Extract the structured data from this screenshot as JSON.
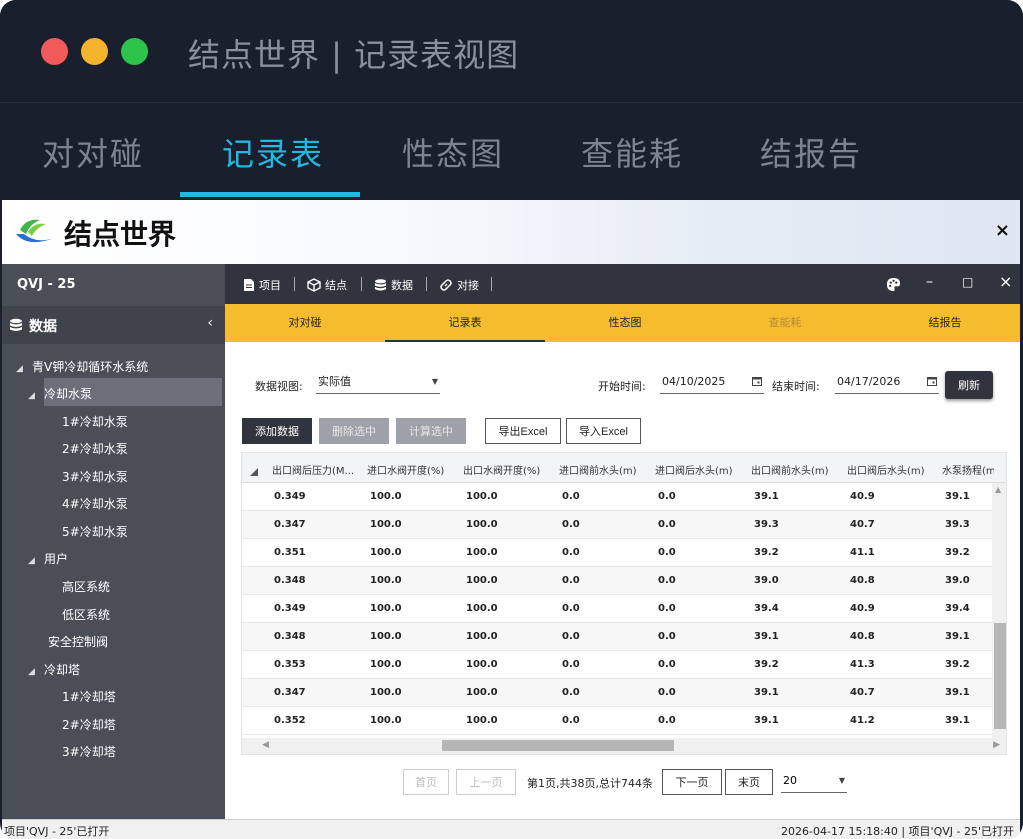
{
  "window": {
    "title": "结点世界 | 记录表视图"
  },
  "big_tabs": [
    {
      "label": "对对碰"
    },
    {
      "label": "记录表"
    },
    {
      "label": "性态图"
    },
    {
      "label": "查能耗"
    },
    {
      "label": "结报告"
    }
  ],
  "app": {
    "logo_text": "结点世界",
    "close_glyph": "×"
  },
  "sidebar": {
    "project": "QVJ - 25",
    "section_label": "数据",
    "chevron": "‹",
    "tree": [
      {
        "label": "青V钾冷却循环水系统"
      },
      {
        "label": "冷却水泵"
      },
      {
        "label": "1#冷却水泵"
      },
      {
        "label": "2#冷却水泵"
      },
      {
        "label": "3#冷却水泵"
      },
      {
        "label": "4#冷却水泵"
      },
      {
        "label": "5#冷却水泵"
      },
      {
        "label": "用户"
      },
      {
        "label": "高区系统"
      },
      {
        "label": "低区系统"
      },
      {
        "label": "安全控制阀"
      },
      {
        "label": "冷却塔"
      },
      {
        "label": "1#冷却塔"
      },
      {
        "label": "2#冷却塔"
      },
      {
        "label": "3#冷却塔"
      }
    ]
  },
  "toolbar": {
    "items": [
      {
        "label": "项目"
      },
      {
        "label": "结点"
      },
      {
        "label": "数据"
      },
      {
        "label": "对接"
      }
    ],
    "win": {
      "minimize": "–",
      "maximize": "□",
      "close": "×"
    }
  },
  "sub_tabs": [
    {
      "label": "对对碰"
    },
    {
      "label": "记录表"
    },
    {
      "label": "性态图"
    },
    {
      "label": "查能耗"
    },
    {
      "label": "结报告"
    }
  ],
  "filters": {
    "view_label": "数据视图:",
    "view_value": "实际值",
    "start_label": "开始时间:",
    "start_value": "04/10/2025",
    "end_label": "结束时间:",
    "end_value": "04/17/2026",
    "refresh": "刷新"
  },
  "actions": {
    "add": "添加数据",
    "delete": "删除选中",
    "compute": "计算选中",
    "export": "导出Excel",
    "import": "导入Excel"
  },
  "table": {
    "headers": [
      "出口阀后压力(M...",
      "进口水阀开度(%)",
      "出口水阀开度(%)",
      "进口阀前水头(m)",
      "进口阀后水头(m)",
      "出口阀前水头(m)",
      "出口阀后水头(m)",
      "水泵扬程(m"
    ],
    "rows": [
      [
        "0.349",
        "100.0",
        "100.0",
        "0.0",
        "0.0",
        "39.1",
        "40.9",
        "39.1"
      ],
      [
        "0.347",
        "100.0",
        "100.0",
        "0.0",
        "0.0",
        "39.3",
        "40.7",
        "39.3"
      ],
      [
        "0.351",
        "100.0",
        "100.0",
        "0.0",
        "0.0",
        "39.2",
        "41.1",
        "39.2"
      ],
      [
        "0.348",
        "100.0",
        "100.0",
        "0.0",
        "0.0",
        "39.0",
        "40.8",
        "39.0"
      ],
      [
        "0.349",
        "100.0",
        "100.0",
        "0.0",
        "0.0",
        "39.4",
        "40.9",
        "39.4"
      ],
      [
        "0.348",
        "100.0",
        "100.0",
        "0.0",
        "0.0",
        "39.1",
        "40.8",
        "39.1"
      ],
      [
        "0.353",
        "100.0",
        "100.0",
        "0.0",
        "0.0",
        "39.2",
        "41.3",
        "39.2"
      ],
      [
        "0.347",
        "100.0",
        "100.0",
        "0.0",
        "0.0",
        "39.1",
        "40.7",
        "39.1"
      ],
      [
        "0.352",
        "100.0",
        "100.0",
        "0.0",
        "0.0",
        "39.1",
        "41.2",
        "39.1"
      ]
    ]
  },
  "pagination": {
    "first": "首页",
    "prev": "上一页",
    "info": "第1页,共38页,总计744条",
    "next": "下一页",
    "last": "末页",
    "page_size": "20"
  },
  "status": {
    "left": "项目'QVJ - 25'已打开",
    "right": "2026-04-17 15:18:40 | 项目'QVJ - 25'已打开"
  },
  "colors": {
    "accent_tab": "#21b8e2",
    "subtab_bar": "#f5bd2d",
    "dark": "#2f343e",
    "sidebar": "#4a4e57"
  }
}
